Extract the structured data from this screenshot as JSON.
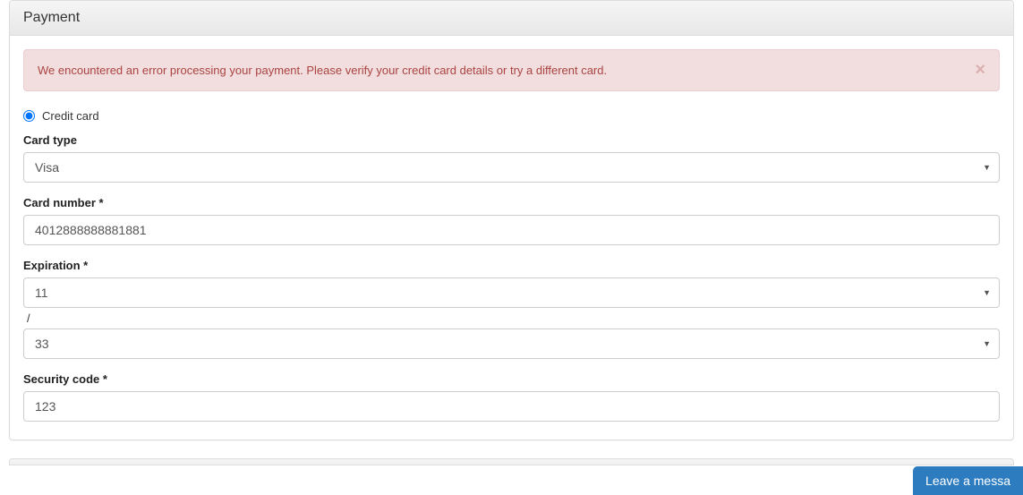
{
  "panel": {
    "title": "Payment"
  },
  "alert": {
    "message": "We encountered an error processing your payment. Please verify your credit card details or try a different card.",
    "close": "×"
  },
  "paymentMethod": {
    "creditCardLabel": "Credit card"
  },
  "form": {
    "cardType": {
      "label": "Card type",
      "value": "Visa"
    },
    "cardNumber": {
      "label": "Card number *",
      "value": "4012888888881881"
    },
    "expiration": {
      "label": "Expiration *",
      "month": "11",
      "separator": "/",
      "year": "33"
    },
    "securityCode": {
      "label": "Security code *",
      "value": "123"
    }
  },
  "chat": {
    "label": "Leave a messa"
  }
}
